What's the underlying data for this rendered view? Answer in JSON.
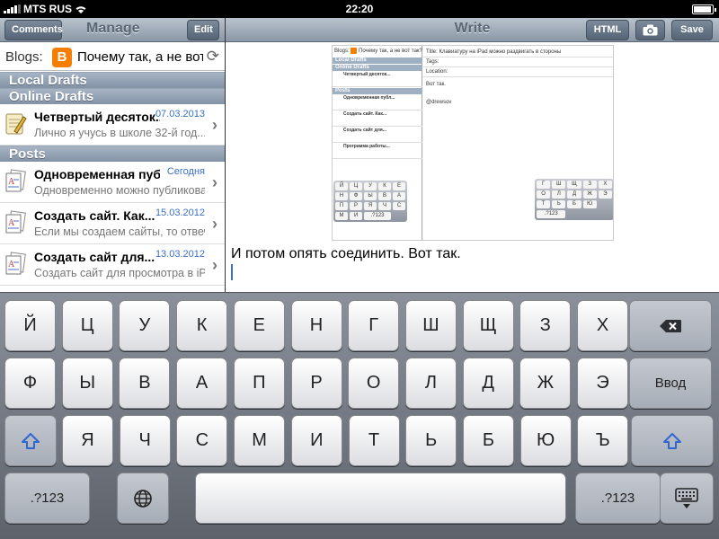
{
  "status_bar": {
    "carrier": "MTS RUS",
    "time": "22:20"
  },
  "left_pane": {
    "nav": {
      "left_button": "Comments",
      "title": "Manage",
      "right_button": "Edit"
    },
    "blogs": {
      "label": "Blogs:",
      "logo_letter": "B",
      "name": "Почему так, а не вот так?"
    },
    "sections": {
      "local_drafts": "Local Drafts",
      "online_drafts": "Online Drafts",
      "posts": "Posts"
    },
    "drafts": [
      {
        "title": "Четвертый десяток...",
        "date": "07.03.2013",
        "excerpt": "Лично я учусь в школе 32-й год..."
      }
    ],
    "posts": [
      {
        "title": "Одновременная публикация",
        "date": "Сегодня",
        "excerpt": "Одновременно можно публиковать..."
      },
      {
        "title": "Создать сайт. Как...",
        "date": "15.03.2012",
        "excerpt": "Если мы создаем сайты, то отвечаем..."
      },
      {
        "title": "Создать сайт для...",
        "date": "13.03.2012",
        "excerpt": "Создать сайт для просмотра в iPhone"
      }
    ]
  },
  "right_pane": {
    "nav": {
      "title": "Write",
      "html_button": "HTML",
      "camera_icon": "camera-icon",
      "save_button": "Save"
    },
    "embedded_screenshot": {
      "blogs_label": "Blogs:",
      "blog_name": "Почему так, а не вот так?",
      "local_drafts": "Local Drafts",
      "online_drafts": "Online Drafts",
      "posts": "Posts",
      "rows": [
        "Четвертый десяток...",
        "Одновременная публ...",
        "Создать сайт. Как...",
        "Создать сайт для...",
        "Программа работы..."
      ],
      "title_label": "Title:",
      "title_value": "Клавиатуру на iPad можно раздвигать в стороны",
      "tags_label": "Tags:",
      "location_label": "Location:",
      "body_1": "Вот так.",
      "body_2": "@drewsov",
      "mini_keys_left": [
        "Й",
        "Ц",
        "У",
        "К",
        "Е",
        "Н",
        "Ф",
        "Ы",
        "В",
        "А",
        "П",
        "Р",
        "Я",
        "Ч",
        "С",
        "М",
        "И"
      ],
      "mini_keys_right": [
        "Г",
        "Ш",
        "Щ",
        "З",
        "Х",
        "О",
        "Л",
        "Д",
        "Ж",
        "Э",
        "Т",
        "Ь",
        "Б",
        "Ю"
      ],
      "mini_numkey": ".?123"
    },
    "body_text": "И потом опять соединить. Вот так."
  },
  "keyboard": {
    "row1": [
      "Й",
      "Ц",
      "У",
      "К",
      "Е",
      "Н",
      "Г",
      "Ш",
      "Щ",
      "З",
      "Х"
    ],
    "row2": [
      "Ф",
      "Ы",
      "В",
      "А",
      "П",
      "Р",
      "О",
      "Л",
      "Д",
      "Ж",
      "Э"
    ],
    "row3": [
      "Я",
      "Ч",
      "С",
      "М",
      "И",
      "Т",
      "Ь",
      "Б",
      "Ю",
      "Ъ"
    ],
    "return_label": "Ввод",
    "numbers_label": ".?123",
    "icons": {
      "backspace": "backspace-icon",
      "shift": "shift-icon",
      "globe": "globe-icon",
      "hide_keyboard": "hide-keyboard-icon"
    },
    "accent_color": "#2f66d0"
  }
}
